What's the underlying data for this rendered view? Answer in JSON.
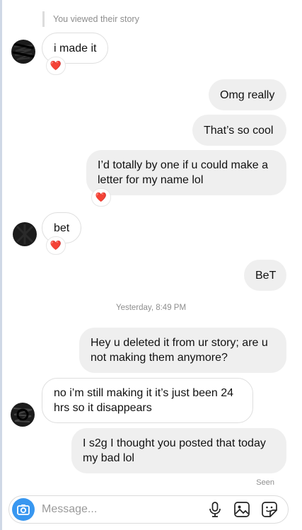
{
  "thread": {
    "reply_note": "You viewed their story",
    "timestamp": "Yesterday, 8:49 PM",
    "seen_label": "Seen"
  },
  "messages": [
    {
      "side": "in",
      "text": "i made it",
      "reaction": "❤️"
    },
    {
      "side": "out",
      "text": "Omg really"
    },
    {
      "side": "out",
      "text": "That’s so cool"
    },
    {
      "side": "out",
      "lines": [
        "I’d totally by one if u could make a",
        "letter for my name lol"
      ],
      "reaction": "❤️"
    },
    {
      "side": "in",
      "text": "bet",
      "reaction": "❤️"
    },
    {
      "side": "out",
      "text": "BeT"
    },
    {
      "side": "out",
      "lines": [
        "Hey u deleted it from ur story; are u",
        "not making them anymore?"
      ]
    },
    {
      "side": "in",
      "lines": [
        "no i’m still making it it’s just been 24",
        "hrs so it disappears"
      ]
    },
    {
      "side": "out",
      "lines": [
        "I s2g I thought you posted that today",
        "my bad lol"
      ]
    }
  ],
  "composer": {
    "placeholder": "Message...",
    "accent": "#3897f0",
    "icons": [
      "camera-icon",
      "microphone-icon",
      "gallery-icon",
      "sticker-icon"
    ]
  },
  "colors": {
    "incoming_bubble": "#ffffff",
    "outgoing_bubble": "#efefef",
    "heart": "#e0245e",
    "muted_text": "#8e8e8e"
  }
}
